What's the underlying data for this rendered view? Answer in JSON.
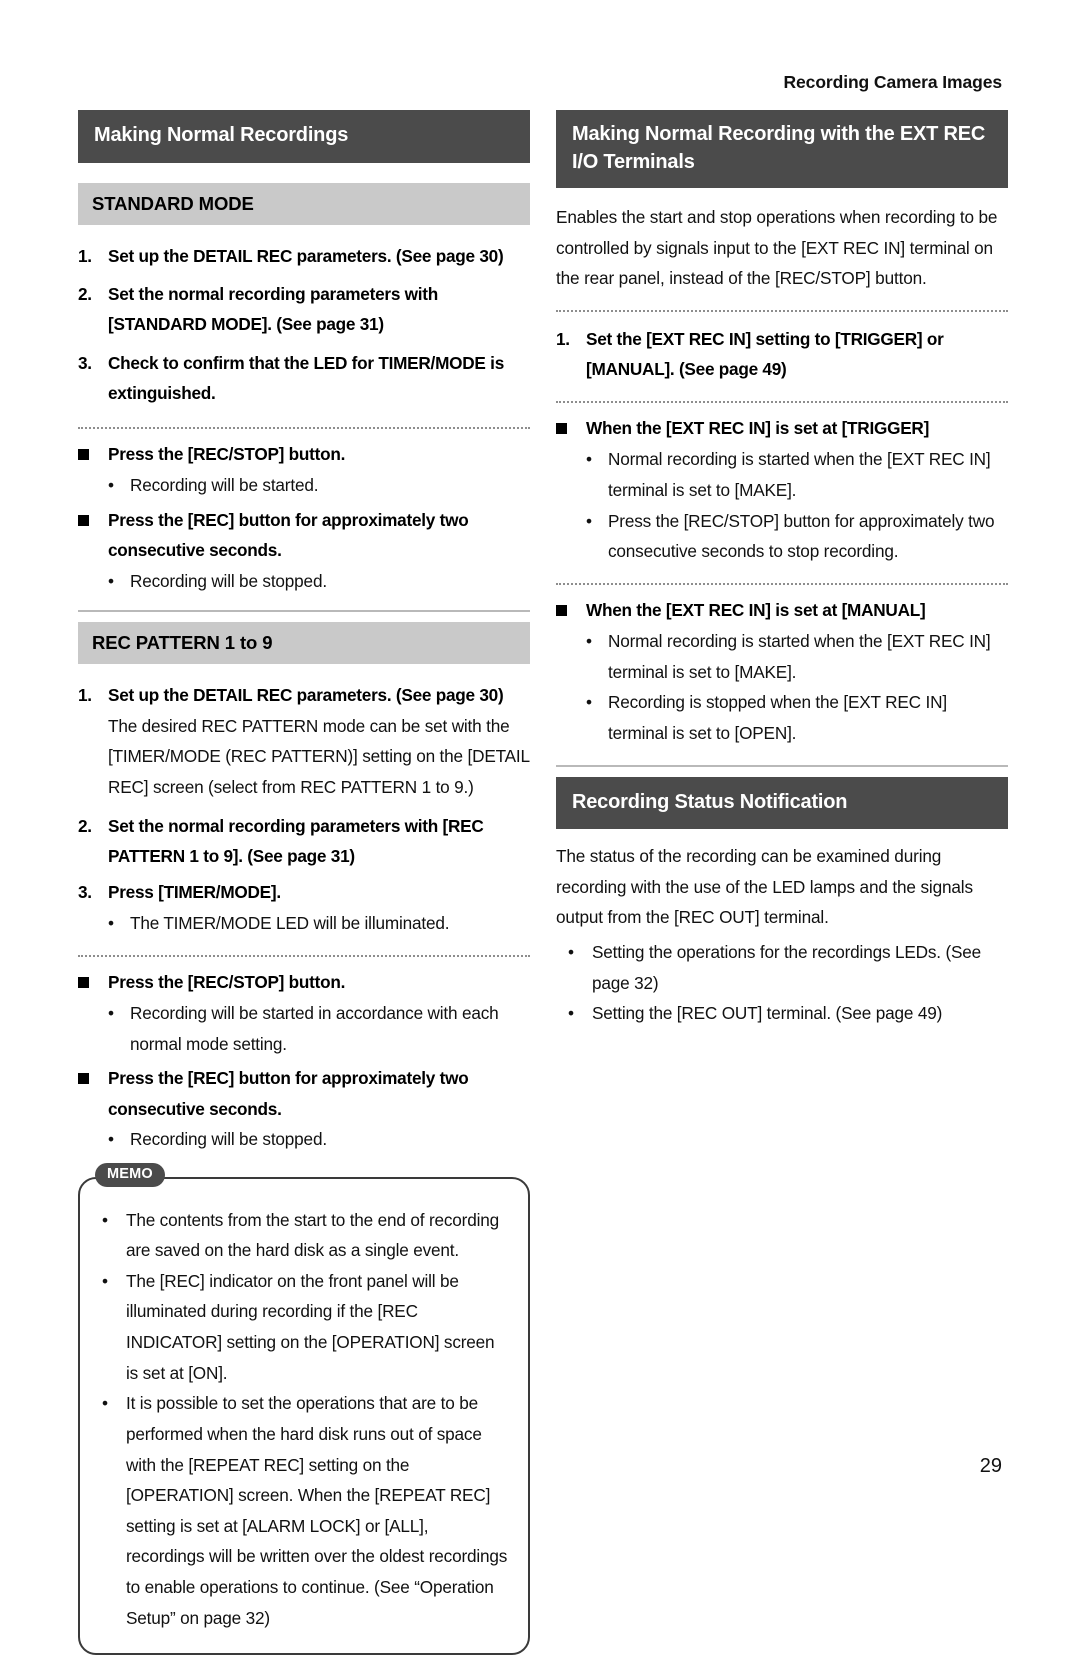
{
  "document": {
    "running_head": "Recording Camera Images",
    "page_number": "29"
  },
  "left_column": {
    "section_title": "Making Normal Recordings",
    "standard_mode": {
      "subhead": "STANDARD MODE",
      "steps": [
        {
          "num": "1.",
          "text": "Set up the DETAIL REC parameters. (See page 30)"
        },
        {
          "num": "2.",
          "text": "Set the normal recording parameters with [STANDARD MODE]. (See page 31)"
        },
        {
          "num": "3.",
          "text": "Check to confirm that the LED for TIMER/MODE is extinguished."
        }
      ],
      "actions": [
        {
          "heading": "Press the [REC/STOP] button.",
          "bullets": [
            "Recording will be started."
          ]
        },
        {
          "heading": "Press the [REC] button for approximately two consecutive seconds.",
          "bullets": [
            "Recording will be stopped."
          ]
        }
      ]
    },
    "rec_pattern": {
      "subhead": "REC PATTERN 1 to 9",
      "step1": {
        "num": "1.",
        "text": "Set up the DETAIL REC parameters. (See page 30)",
        "detail": "The desired REC PATTERN mode can be set with the [TIMER/MODE (REC PATTERN)] setting on the [DETAIL REC] screen (select from REC PATTERN 1 to 9.)"
      },
      "step2": {
        "num": "2.",
        "text": "Set the normal recording parameters with [REC PATTERN 1 to 9]. (See page 31)"
      },
      "step3": {
        "num": "3.",
        "text": "Press [TIMER/MODE]."
      },
      "step3_bullet": "The TIMER/MODE LED will be illuminated.",
      "actions": [
        {
          "heading": "Press the [REC/STOP] button.",
          "bullets": [
            "Recording will be started in accordance with each normal mode setting."
          ]
        },
        {
          "heading": "Press the [REC] button for approximately two consecutive seconds.",
          "bullets": [
            "Recording will be stopped."
          ]
        }
      ]
    },
    "memo": {
      "badge": "MEMO",
      "items": [
        "The contents from the start to the end of recording are saved on the hard disk as a single event.",
        "The [REC] indicator on the front panel will be illuminated during recording if the [REC INDICATOR] setting on the [OPERATION] screen is set at [ON].",
        "It is possible to set the operations that are to be performed when the hard disk runs out of space with the [REPEAT REC] setting on the [OPERATION] screen. When the [REPEAT REC] setting is set at [ALARM LOCK] or [ALL], recordings will be written over the oldest recordings to enable operations to continue. (See “Operation Setup” on page 32)"
      ]
    }
  },
  "right_column": {
    "ext_rec": {
      "section_title": "Making Normal Recording with the EXT REC I/O Terminals",
      "intro": "Enables the start and stop operations when recording to be controlled by signals input to the [EXT REC IN] terminal on the rear panel, instead of the [REC/STOP] button.",
      "step1": {
        "num": "1.",
        "text": "Set the [EXT REC IN] setting to [TRIGGER] or [MANUAL]. (See page 49)"
      },
      "trigger": {
        "heading": "When the [EXT REC IN] is set at [TRIGGER]",
        "bullets": [
          "Normal recording is started when the [EXT REC IN] terminal is set to [MAKE].",
          "Press the [REC/STOP] button for approximately two consecutive seconds to stop recording."
        ]
      },
      "manual": {
        "heading": "When the [EXT REC IN] is set at [MANUAL]",
        "bullets": [
          "Normal recording is started when the [EXT REC IN] terminal is set to [MAKE].",
          "Recording is stopped when the [EXT REC IN] terminal is set to [OPEN]."
        ]
      }
    },
    "status_notification": {
      "section_title": "Recording Status Notification",
      "intro": "The status of the recording can be examined during recording with the use of the LED lamps and the signals output from the [REC OUT] terminal.",
      "bullets": [
        "Setting the operations for the recordings LEDs. (See page 32)",
        "Setting the [REC OUT] terminal. (See page 49)"
      ]
    }
  },
  "glyphs": {
    "bullet_dot": "•",
    "memo_dot": "•"
  }
}
